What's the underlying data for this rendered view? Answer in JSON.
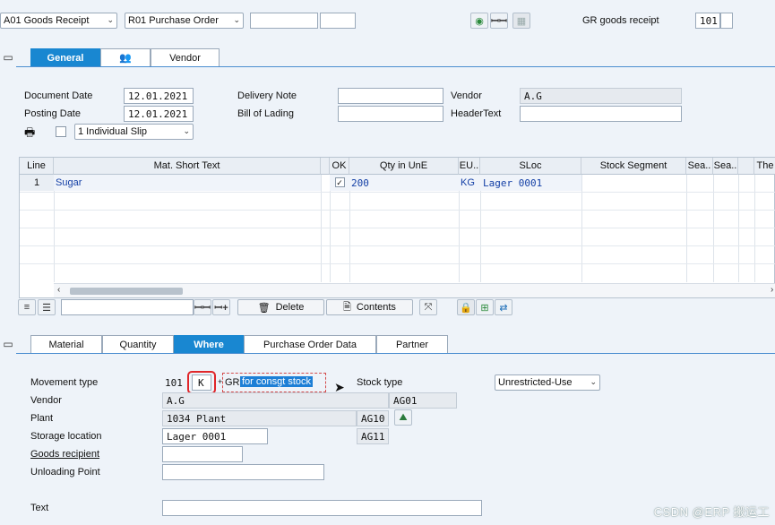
{
  "header": {
    "action_select": "A01 Goods Receipt",
    "ref_select": "R01 Purchase Order",
    "ref_input1": "",
    "ref_input2": "",
    "mvmt_label": "GR goods receipt",
    "mvmt_code": "101",
    "mvmt_extra": ""
  },
  "header_tabs": [
    {
      "label": "General",
      "active": true
    },
    {
      "label": "",
      "icon": "people-icon"
    },
    {
      "label": "Vendor"
    }
  ],
  "general": {
    "document_date_label": "Document Date",
    "document_date": "12.01.2021",
    "posting_date_label": "Posting Date",
    "posting_date": "12.01.2021",
    "delivery_note_label": "Delivery Note",
    "delivery_note": "",
    "bill_of_lading_label": "Bill of Lading",
    "bill_of_lading": "",
    "vendor_label": "Vendor",
    "vendor_value": "A.G",
    "header_text_label": "HeaderText",
    "header_text": "",
    "slip_select": "1 Individual Slip"
  },
  "items_table": {
    "columns": [
      "Line",
      "Mat. Short Text",
      "",
      "OK",
      "Qty in UnE",
      "EU..",
      "SLoc",
      "Stock Segment",
      "Sea..",
      "Sea..",
      "",
      "The"
    ],
    "rows": [
      {
        "line": "1",
        "material": "Sugar",
        "ok": "✓",
        "qty": "200",
        "eu": "KG",
        "sloc": "Lager 0001"
      }
    ]
  },
  "item_toolbar": {
    "search_value": "",
    "delete_label": "Delete",
    "contents_label": "Contents"
  },
  "detail_tabs": [
    {
      "label": "Material"
    },
    {
      "label": "Quantity"
    },
    {
      "label": "Where",
      "active": true
    },
    {
      "label": "Purchase Order Data"
    },
    {
      "label": "Partner"
    }
  ],
  "where": {
    "movement_type_label": "Movement type",
    "movement_type_code": "101",
    "movement_type_special": "K",
    "movement_type_plus": "+",
    "movement_type_gr": "GR",
    "movement_type_desc": "for consgt stock",
    "stock_type_label": "Stock type",
    "stock_type_value": "Unrestricted-Use",
    "vendor_label": "Vendor",
    "vendor_value": "A.G",
    "vendor_code": "AG01",
    "plant_label": "Plant",
    "plant_value": "1034 Plant",
    "plant_code": "AG10",
    "storage_location_label": "Storage location",
    "storage_location_value": "Lager 0001",
    "storage_location_code": "AG11",
    "goods_recipient_label": "Goods recipient",
    "goods_recipient_value": "",
    "unloading_point_label": "Unloading Point",
    "unloading_point_value": "",
    "text_label": "Text",
    "text_value": ""
  },
  "watermark": "CSDN @ERP 搬运工",
  "colors": {
    "accent": "#1987d1",
    "highlight": "#1d7fd6",
    "red_box": "#e0262a"
  }
}
